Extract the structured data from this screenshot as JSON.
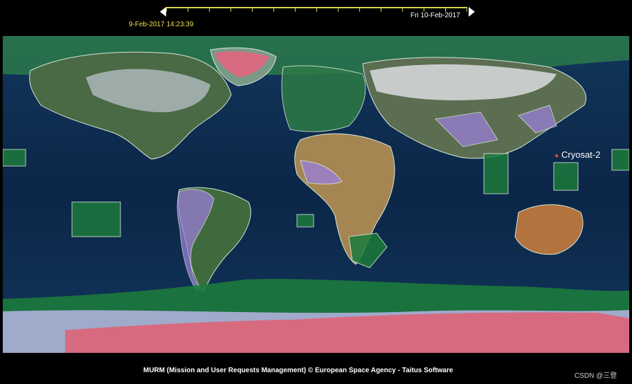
{
  "timeline": {
    "start_label": "9-Feb-2017 14:23:39",
    "end_label": "Fri 10-Feb-2017"
  },
  "map": {
    "satellite_label": "Cryosat-2",
    "colors": {
      "ocean": "#0d2a4d",
      "land": "#3d5a3a",
      "green_zone": "#1c7a3c",
      "violet_zone": "#9a7fd6",
      "red_zone": "#d86a80",
      "white_outline": "#d8e8d8"
    }
  },
  "footer": {
    "credit": "MURM (Mission and User Requests Management) © European Space Agency - Taitus Software",
    "watermark": "CSDN @三登"
  }
}
